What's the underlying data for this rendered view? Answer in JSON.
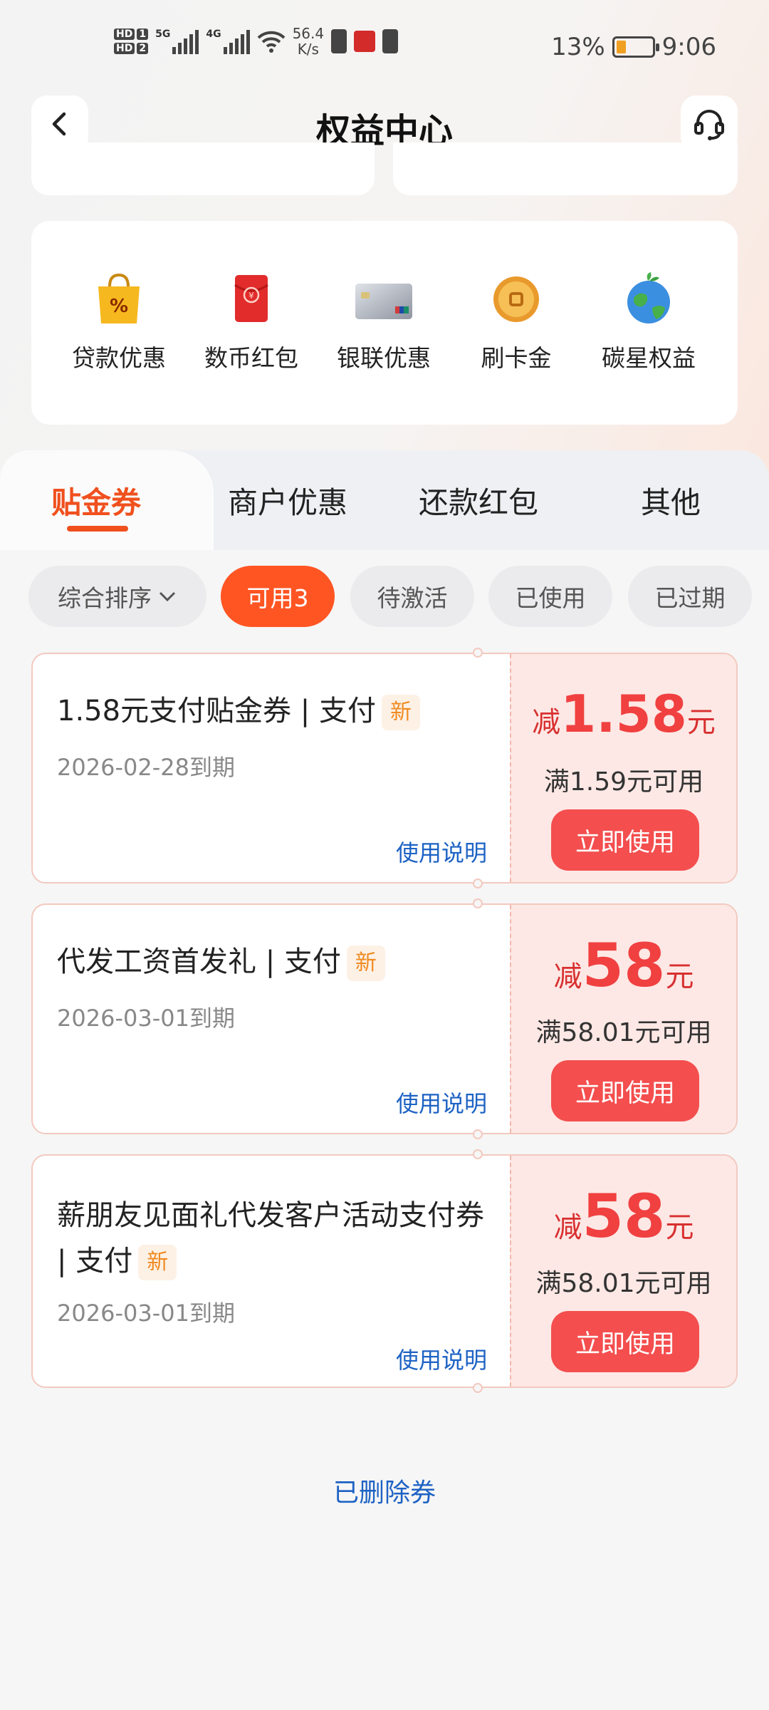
{
  "status_bar": {
    "hd1": "HD",
    "hd1_num": "1",
    "hd2": "HD",
    "hd2_num": "2",
    "sig1": "5G",
    "sig2": "4G",
    "speed_value": "56.4",
    "speed_unit": "K/s",
    "battery_percent": "13%",
    "time": "9:06"
  },
  "header": {
    "title": "权益中心"
  },
  "benefits": [
    {
      "label": "贷款优惠",
      "icon": "shopping-bag-icon"
    },
    {
      "label": "数币红包",
      "icon": "red-envelope-icon"
    },
    {
      "label": "银联优惠",
      "icon": "unionpay-card-icon"
    },
    {
      "label": "刷卡金",
      "icon": "gold-coin-icon"
    },
    {
      "label": "碳星权益",
      "icon": "earth-icon"
    }
  ],
  "tabs": [
    "贴金券",
    "商户优惠",
    "还款红包",
    "其他"
  ],
  "filters": {
    "sort": "综合排序",
    "available": "可用3",
    "pending": "待激活",
    "used": "已使用",
    "expired": "已过期"
  },
  "coupons": [
    {
      "title": "1.58元支付贴金券 | 支付",
      "tag": "新",
      "date": "2026-02-28到期",
      "instructions": "使用说明",
      "prefix": "减",
      "amount": "1.58",
      "unit": "元",
      "condition": "满1.59元可用",
      "button": "立即使用"
    },
    {
      "title": "代发工资首发礼 | 支付",
      "tag": "新",
      "date": "2026-03-01到期",
      "instructions": "使用说明",
      "prefix": "减",
      "amount": "58",
      "unit": "元",
      "condition": "满58.01元可用",
      "button": "立即使用"
    },
    {
      "title": "薪朋友见面礼代发客户活动支付券 | 支付",
      "tag": "新",
      "date": "2026-03-01到期",
      "instructions": "使用说明",
      "prefix": "减",
      "amount": "58",
      "unit": "元",
      "condition": "满58.01元可用",
      "button": "立即使用"
    }
  ],
  "footer": {
    "deleted_link": "已删除券"
  },
  "colors": {
    "accent": "#ff5523",
    "coupon_red": "#f04040",
    "link_blue": "#1d62c4"
  }
}
